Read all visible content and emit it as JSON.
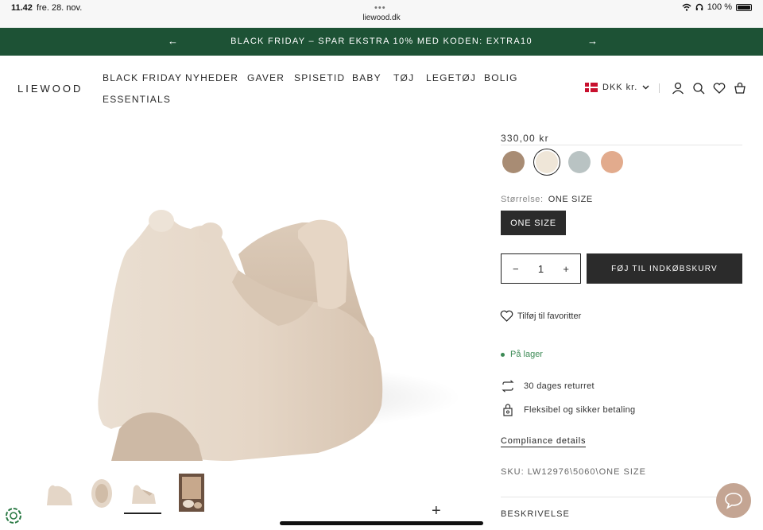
{
  "status_bar": {
    "time": "11.42",
    "date": "fre. 28. nov.",
    "dots": "•••",
    "url": "liewood.dk",
    "battery": "100 %"
  },
  "announcement": {
    "text": "BLACK FRIDAY – SPAR EKSTRA 10% MED KODEN: EXTRA10"
  },
  "header": {
    "logo": "LIEWOOD",
    "nav": [
      "BLACK FRIDAY",
      "NYHEDER",
      "GAVER",
      "SPISETID",
      "BABY",
      "TØJ",
      "LEGETØJ",
      "BOLIG",
      "ESSENTIALS"
    ],
    "currency": "DKK kr."
  },
  "product": {
    "price": "330,00 kr",
    "swatches": [
      {
        "color": "#a88c74",
        "selected": false
      },
      {
        "color": "#efe6d8",
        "selected": true
      },
      {
        "color": "#b9c3c3",
        "selected": false
      },
      {
        "color": "#e2ab8d",
        "selected": false
      }
    ],
    "size_key": "Størrelse:",
    "size_value": "ONE SIZE",
    "size_option": "ONE SIZE",
    "quantity": "1",
    "qty_minus": "−",
    "qty_plus": "+",
    "add_to_cart": "FØJ TIL INDKØBSKURV",
    "favorite": "Tilføj til favoritter",
    "stock": "På lager",
    "returns": "30 dages returret",
    "payment": "Fleksibel og sikker betaling",
    "compliance": "Compliance details",
    "sku": "SKU: LW12976\\5060\\ONE SIZE",
    "description": "BESKRIVELSE"
  },
  "gallery": {
    "expand": "+"
  },
  "colors": {
    "brand_green": "#1d5235",
    "dark": "#2b2b2b",
    "stock_green": "#3c8a55",
    "chat": "#c4a593"
  }
}
